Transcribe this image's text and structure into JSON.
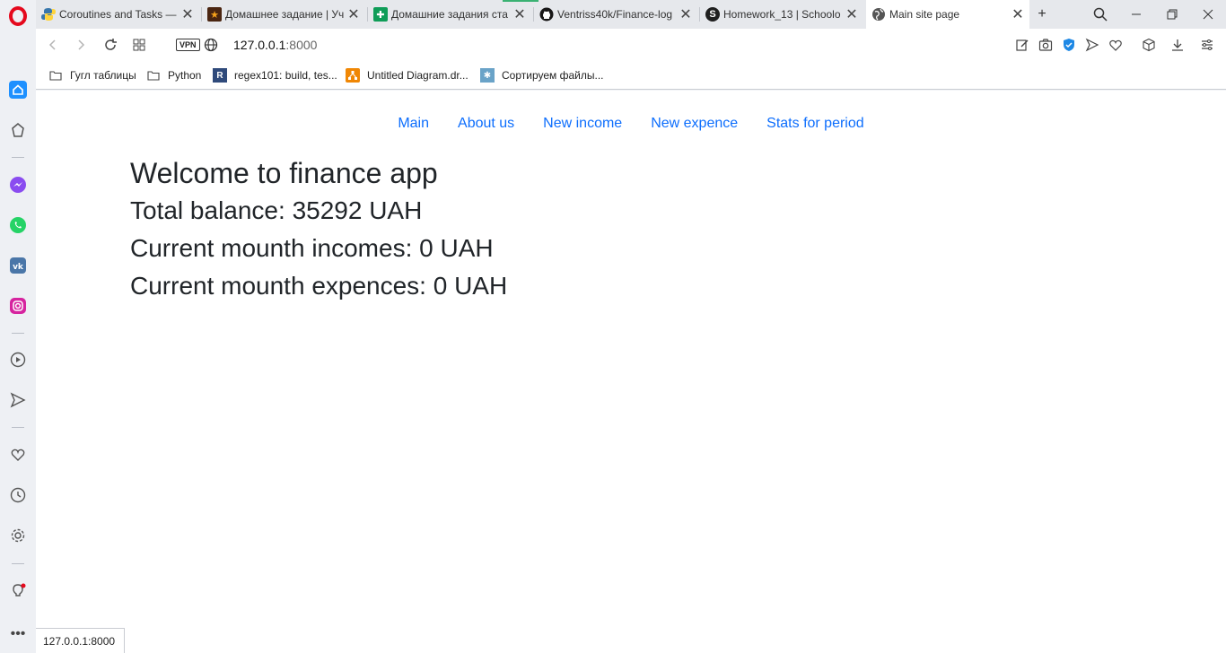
{
  "tabs": [
    {
      "title": "Coroutines and Tasks —",
      "icon": "python-icon",
      "color": "#3776ab"
    },
    {
      "title": "Домашнее задание | Уч",
      "icon": "star-icon",
      "color": "#4a2511"
    },
    {
      "title": "Домашние задания ста",
      "icon": "sheets-icon",
      "color": "#0f9d58"
    },
    {
      "title": "Ventriss40k/Finance-log",
      "icon": "github-icon",
      "color": "#181717"
    },
    {
      "title": "Homework_13 | Schoolo",
      "icon": "schoology-icon",
      "color": "#1f1f1f"
    },
    {
      "title": "Main site page",
      "icon": "globe-icon",
      "color": "#555555"
    }
  ],
  "address": {
    "vpn": "VPN",
    "host": "127.0.0.1",
    "port": ":8000"
  },
  "bookmarks": [
    {
      "label": "Гугл таблицы",
      "icon": "folder-icon"
    },
    {
      "label": "Python",
      "icon": "folder-icon"
    },
    {
      "label": "regex101: build, tes...",
      "icon": "regex101-icon",
      "glyph": "R"
    },
    {
      "label": "Untitled Diagram.dr...",
      "icon": "drawio-icon"
    },
    {
      "label": "Сортируем файлы...",
      "icon": "gear-favicon-icon"
    }
  ],
  "nav": [
    "Main",
    "About us",
    "New income",
    "New expence",
    "Stats for period"
  ],
  "content": {
    "heading": "Welcome to finance app",
    "balance": "Total balance: 35292 UAH",
    "incomes": "Current mounth incomes: 0 UAH",
    "expences": "Current mounth expences: 0 UAH"
  },
  "status": "127.0.0.1:8000",
  "colors": {
    "link": "#0d6efd",
    "text": "#212529",
    "opera": "#e5091d"
  }
}
